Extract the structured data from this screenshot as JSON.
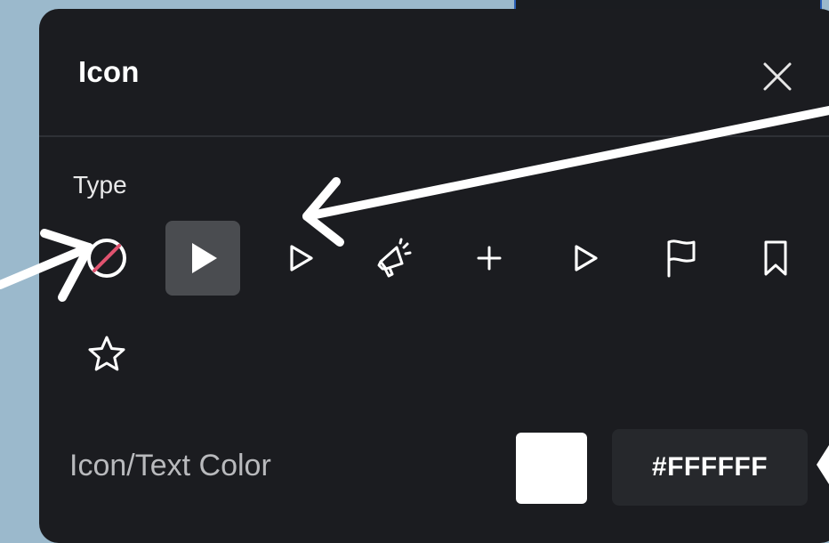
{
  "panel": {
    "title": "Icon",
    "close_icon": "close-icon"
  },
  "type_section": {
    "label": "Type",
    "icons": [
      {
        "name": "none-icon",
        "selected": false
      },
      {
        "name": "play-filled-icon",
        "selected": true
      },
      {
        "name": "play-outline-icon",
        "selected": false
      },
      {
        "name": "megaphone-icon",
        "selected": false
      },
      {
        "name": "plus-icon",
        "selected": false
      },
      {
        "name": "play-outline-icon",
        "selected": false
      },
      {
        "name": "flag-icon",
        "selected": false
      },
      {
        "name": "bookmark-icon",
        "selected": false
      },
      {
        "name": "star-icon",
        "selected": false
      }
    ]
  },
  "color_section": {
    "label": "Icon/Text Color",
    "swatch_color": "#FFFFFF",
    "hex_value": "#FFFFFF"
  },
  "colors": {
    "panel_bg": "#1b1c20",
    "selected_bg": "#4a4c50",
    "none_slash": "#e0536f",
    "background": "#9bb9cc"
  }
}
